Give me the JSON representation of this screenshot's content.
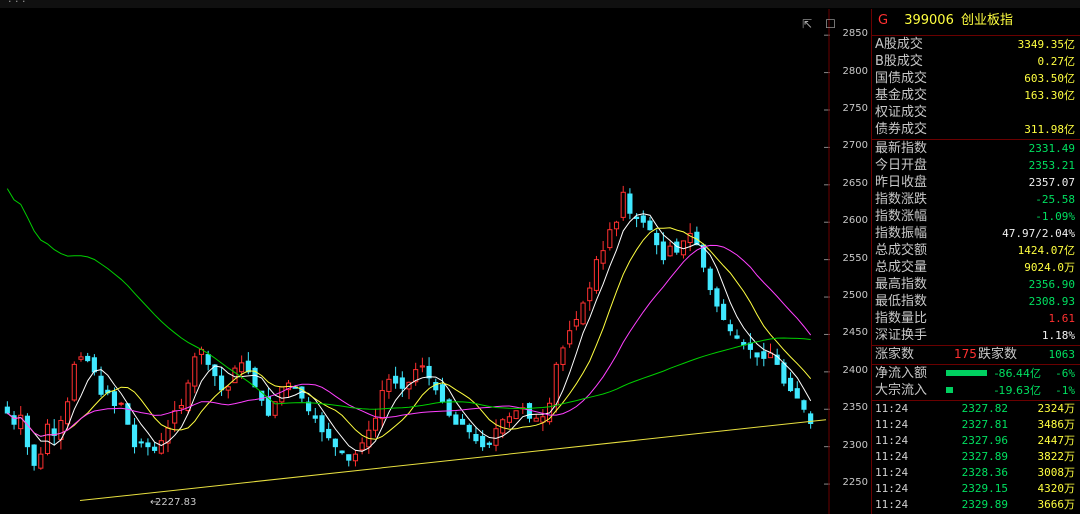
{
  "panel": {
    "code_prefix": "G",
    "code": "399006",
    "name": "创业板指",
    "turnover": [
      {
        "label": "A股成交",
        "value": "3349.35亿"
      },
      {
        "label": "B股成交",
        "value": "0.27亿"
      },
      {
        "label": "国债成交",
        "value": "603.50亿"
      },
      {
        "label": "基金成交",
        "value": "163.30亿"
      },
      {
        "label": "权证成交",
        "value": ""
      },
      {
        "label": "债券成交",
        "value": "311.98亿"
      }
    ],
    "stats": [
      {
        "label": "最新指数",
        "value": "2331.49",
        "color": "green"
      },
      {
        "label": "今日开盘",
        "value": "2353.21",
        "color": "green"
      },
      {
        "label": "昨日收盘",
        "value": "2357.07",
        "color": "white"
      },
      {
        "label": "指数涨跌",
        "value": "-25.58",
        "color": "green"
      },
      {
        "label": "指数涨幅",
        "value": "-1.09%",
        "color": "green"
      },
      {
        "label": "指数振幅",
        "value": "47.97/2.04%",
        "color": "white"
      },
      {
        "label": "总成交额",
        "value": "1424.07亿",
        "color": "yellow"
      },
      {
        "label": "总成交量",
        "value": "9024.0万",
        "color": "yellow"
      },
      {
        "label": "最高指数",
        "value": "2356.90",
        "color": "green"
      },
      {
        "label": "最低指数",
        "value": "2308.93",
        "color": "green"
      },
      {
        "label": "指数量比",
        "value": "1.61",
        "color": "red"
      },
      {
        "label": "深证换手",
        "value": "1.18%",
        "color": "white"
      }
    ],
    "breadth": {
      "up_label": "涨家数",
      "up_value": "175",
      "down_label": "跌家数",
      "down_value": "1063"
    },
    "flows": [
      {
        "label": "净流入额",
        "value": "-86.44亿",
        "pct": "-6%",
        "bar": 0.6
      },
      {
        "label": "大宗流入",
        "value": "-19.63亿",
        "pct": "-1%",
        "bar": 0.1
      }
    ],
    "ticks": [
      {
        "time": "11:24",
        "price": "2327.82",
        "vol": "2324万"
      },
      {
        "time": "11:24",
        "price": "2327.81",
        "vol": "3486万"
      },
      {
        "time": "11:24",
        "price": "2327.96",
        "vol": "2447万"
      },
      {
        "time": "11:24",
        "price": "2327.89",
        "vol": "3822万"
      },
      {
        "time": "11:24",
        "price": "2328.36",
        "vol": "3008万"
      },
      {
        "time": "11:24",
        "price": "2329.15",
        "vol": "4320万"
      },
      {
        "time": "11:24",
        "price": "2329.89",
        "vol": "3666万"
      }
    ]
  },
  "chart_data": {
    "type": "candlestick",
    "y_ticks": [
      2850,
      2800,
      2750,
      2700,
      2650,
      2600,
      2550,
      2500,
      2450,
      2400,
      2350,
      2300,
      2250
    ],
    "ylim": [
      2210,
      2885
    ],
    "low_marker": "2227.83",
    "colors": {
      "up": "#ff3030",
      "down": "#40e8ff",
      "ma5": "#ffffff",
      "ma10": "#ffff40",
      "ma20": "#ff40ff",
      "ma60": "#00d000",
      "trend": "#e8e040"
    },
    "closes": [
      2345,
      2330,
      2342,
      2300,
      2275,
      2290,
      2330,
      2315,
      2335,
      2360,
      2410,
      2420,
      2415,
      2400,
      2370,
      2372,
      2355,
      2358,
      2330,
      2300,
      2305,
      2300,
      2295,
      2308,
      2325,
      2348,
      2355,
      2385,
      2420,
      2430,
      2410,
      2395,
      2376,
      2380,
      2405,
      2412,
      2400,
      2380,
      2362,
      2342,
      2360,
      2380,
      2385,
      2378,
      2365,
      2348,
      2338,
      2320,
      2312,
      2300,
      2292,
      2282,
      2290,
      2305,
      2322,
      2338,
      2375,
      2390,
      2385,
      2378,
      2386,
      2403,
      2408,
      2392,
      2376,
      2360,
      2342,
      2330,
      2330,
      2320,
      2308,
      2300,
      2303,
      2324,
      2336,
      2340,
      2348,
      2352,
      2338,
      2338,
      2340,
      2358,
      2410,
      2432,
      2455,
      2470,
      2492,
      2512,
      2550,
      2562,
      2590,
      2600,
      2640,
      2612,
      2605,
      2600,
      2590,
      2570,
      2550,
      2568,
      2560,
      2575,
      2585,
      2570,
      2540,
      2510,
      2488,
      2470,
      2455,
      2445,
      2436,
      2430,
      2420,
      2418,
      2425,
      2410,
      2385,
      2375,
      2365,
      2350,
      2331
    ]
  }
}
